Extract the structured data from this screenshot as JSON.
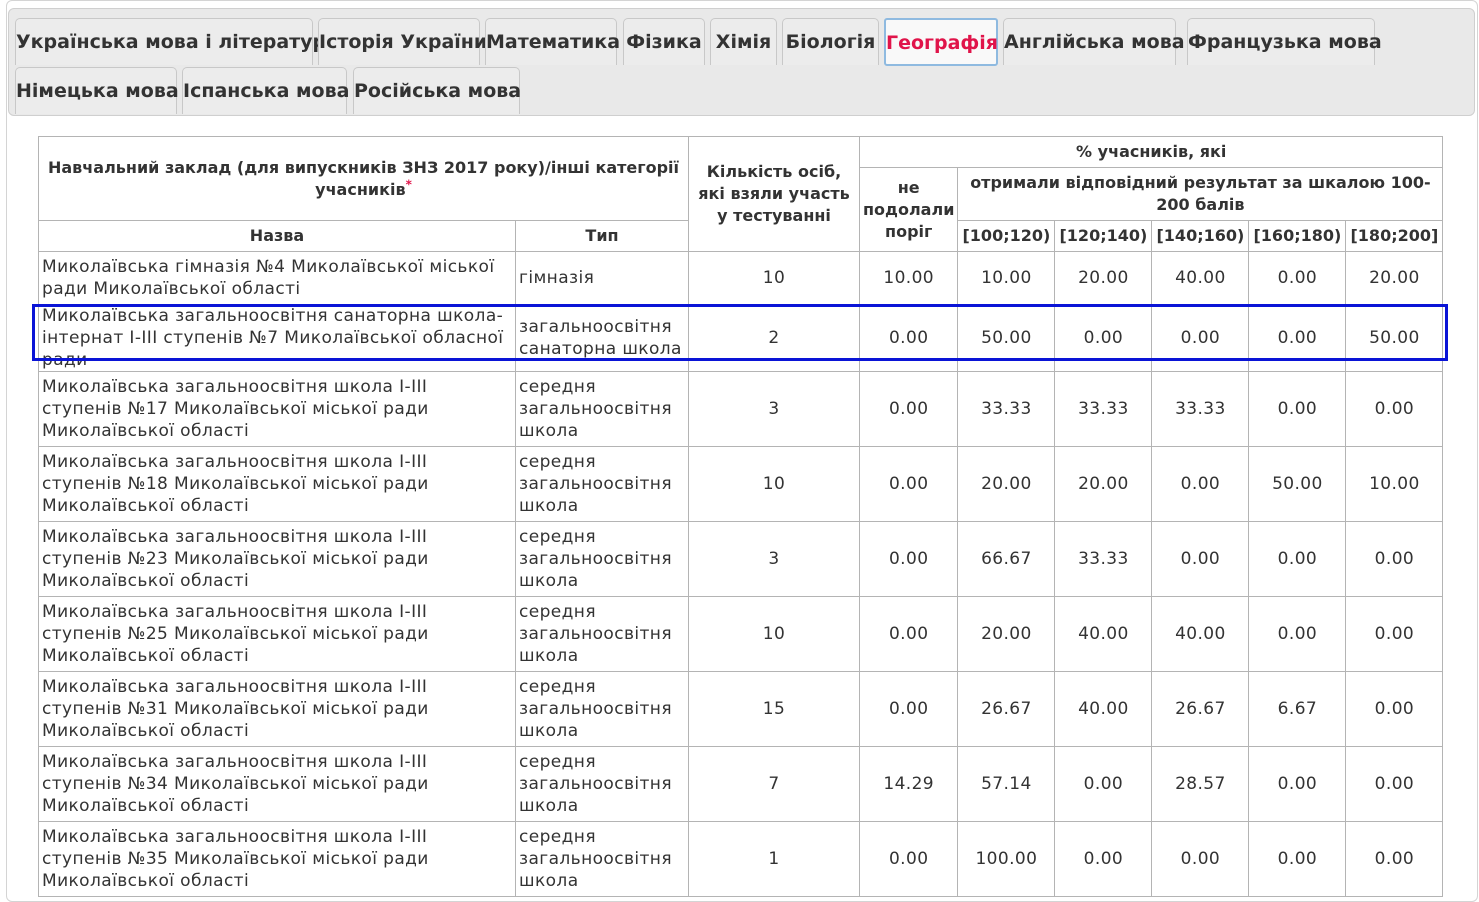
{
  "tabs": [
    {
      "id": "ukr",
      "label": "Українська мова і література"
    },
    {
      "id": "hist",
      "label": "Історія України"
    },
    {
      "id": "math",
      "label": "Математика"
    },
    {
      "id": "phys",
      "label": "Фізика"
    },
    {
      "id": "chem",
      "label": "Хімія"
    },
    {
      "id": "bio",
      "label": "Біологія"
    },
    {
      "id": "geo",
      "label": "Географія"
    },
    {
      "id": "eng",
      "label": "Англійська мова"
    },
    {
      "id": "fr",
      "label": "Французька мова"
    },
    {
      "id": "de",
      "label": "Німецька мова"
    },
    {
      "id": "es",
      "label": "Іспанська мова"
    },
    {
      "id": "ru",
      "label": "Російська мова"
    }
  ],
  "active_tab": "Географія",
  "table": {
    "header": {
      "institution": "Навчальний заклад (для випускників ЗНЗ 2017 року)/інші категорії учасників",
      "required_mark": "*",
      "name": "Назва",
      "type": "Тип",
      "count": "Кількість осіб, які взяли участь у тестуванні",
      "percent": "% учасників, які",
      "failed": "не подолали поріг",
      "scale": "отримали відповідний результат за шкалою 100-200 балів",
      "ranges": [
        "[100;120)",
        "[120;140)",
        "[140;160)",
        "[160;180)",
        "[180;200]"
      ]
    },
    "rows": [
      {
        "name": "Миколаївська гімназія №4 Миколаївської міської ради Миколаївської області",
        "type": "гімназія",
        "count": "10",
        "failed": "10.00",
        "r1": "10.00",
        "r2": "20.00",
        "r3": "40.00",
        "r4": "0.00",
        "r5": "20.00"
      },
      {
        "name": "Миколаївська загальноосвітня санаторна школа-інтернат І-ІІІ ступенів №7 Миколаївської обласної ради",
        "type": "загальноосвітня санаторна школа",
        "count": "2",
        "failed": "0.00",
        "r1": "50.00",
        "r2": "0.00",
        "r3": "0.00",
        "r4": "0.00",
        "r5": "50.00"
      },
      {
        "name": "Миколаївська загальноосвітня школа І-ІІІ ступенів №17 Миколаївської міської ради Миколаївської області",
        "type": "середня загальноосвітня школа",
        "count": "3",
        "failed": "0.00",
        "r1": "33.33",
        "r2": "33.33",
        "r3": "33.33",
        "r4": "0.00",
        "r5": "0.00"
      },
      {
        "name": "Миколаївська загальноосвітня школа І-ІІІ ступенів №18 Миколаївської міської ради Миколаївської області",
        "type": "середня загальноосвітня школа",
        "count": "10",
        "failed": "0.00",
        "r1": "20.00",
        "r2": "20.00",
        "r3": "0.00",
        "r4": "50.00",
        "r5": "10.00"
      },
      {
        "name": "Миколаївська загальноосвітня школа І-ІІІ ступенів №23 Миколаївської міської ради Миколаївської області",
        "type": "середня загальноосвітня школа",
        "count": "3",
        "failed": "0.00",
        "r1": "66.67",
        "r2": "33.33",
        "r3": "0.00",
        "r4": "0.00",
        "r5": "0.00"
      },
      {
        "name": "Миколаївська загальноосвітня школа І-ІІІ ступенів №25 Миколаївської міської ради Миколаївської області",
        "type": "середня загальноосвітня школа",
        "count": "10",
        "failed": "0.00",
        "r1": "20.00",
        "r2": "40.00",
        "r3": "40.00",
        "r4": "0.00",
        "r5": "0.00"
      },
      {
        "name": "Миколаївська загальноосвітня школа І-ІІІ ступенів №31 Миколаївської міської ради Миколаївської області",
        "type": "середня загальноосвітня школа",
        "count": "15",
        "failed": "0.00",
        "r1": "26.67",
        "r2": "40.00",
        "r3": "26.67",
        "r4": "6.67",
        "r5": "0.00"
      },
      {
        "name": "Миколаївська загальноосвітня школа І-ІІІ ступенів №34 Миколаївської міської ради Миколаївської області",
        "type": "середня загальноосвітня школа",
        "count": "7",
        "failed": "14.29",
        "r1": "57.14",
        "r2": "0.00",
        "r3": "28.57",
        "r4": "0.00",
        "r5": "0.00"
      },
      {
        "name": "Миколаївська загальноосвітня школа І-ІІІ ступенів №35 Миколаївської міської ради Миколаївської області",
        "type": "середня загальноосвітня школа",
        "count": "1",
        "failed": "0.00",
        "r1": "100.00",
        "r2": "0.00",
        "r3": "0.00",
        "r4": "0.00",
        "r5": "0.00"
      }
    ]
  },
  "colors": {
    "active_tab_text": "#e0144a",
    "active_tab_border": "#8fbae0",
    "highlight_border": "#0a14d6",
    "text": "#333333",
    "grid": "#b4b4b4"
  }
}
